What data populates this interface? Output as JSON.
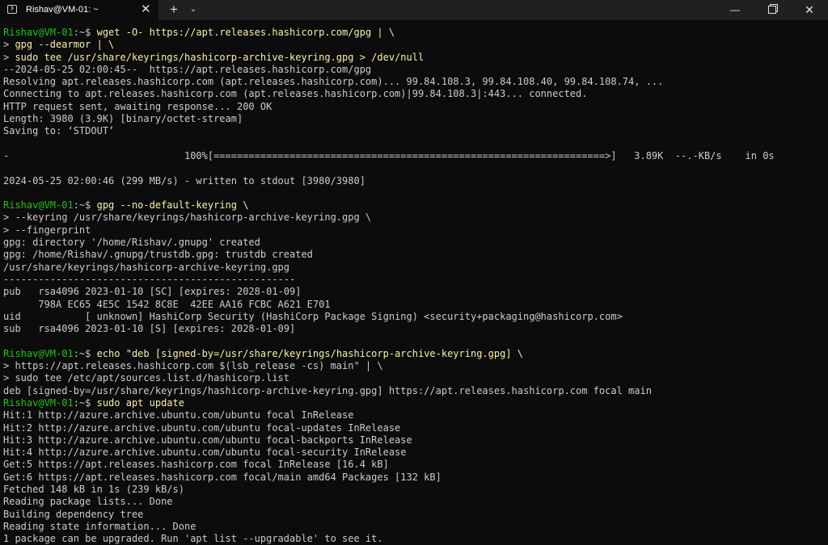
{
  "window": {
    "tab_title": "Rishav@VM-01: ~",
    "tab_close": "✕",
    "new_tab": "+",
    "dropdown": "⌄",
    "minimize": "—",
    "close": "✕"
  },
  "terminal": {
    "prompt_user": "Rishav@VM-01",
    "prompt_path": ":~$ ",
    "lines": [
      {
        "kind": "prompt",
        "cmd": "wget -O- https://apt.releases.hashicorp.com/gpg | \\"
      },
      {
        "kind": "cont",
        "text": "> ",
        "cmd": "gpg --dearmor | \\"
      },
      {
        "kind": "cont",
        "text": "> ",
        "cmd": "sudo tee /usr/share/keyrings/hashicorp-archive-keyring.gpg > /dev/null"
      },
      {
        "kind": "out",
        "text": "--2024-05-25 02:00:45--  https://apt.releases.hashicorp.com/gpg"
      },
      {
        "kind": "out",
        "text": "Resolving apt.releases.hashicorp.com (apt.releases.hashicorp.com)... 99.84.108.3, 99.84.108.40, 99.84.108.74, ..."
      },
      {
        "kind": "out",
        "text": "Connecting to apt.releases.hashicorp.com (apt.releases.hashicorp.com)|99.84.108.3|:443... connected."
      },
      {
        "kind": "out",
        "text": "HTTP request sent, awaiting response... 200 OK"
      },
      {
        "kind": "out",
        "text": "Length: 3980 (3.9K) [binary/octet-stream]"
      },
      {
        "kind": "out",
        "text": "Saving to: ‘STDOUT’"
      },
      {
        "kind": "out",
        "text": ""
      },
      {
        "kind": "out",
        "text": "-                              100%[===================================================================>]   3.89K  --.-KB/s    in 0s"
      },
      {
        "kind": "out",
        "text": ""
      },
      {
        "kind": "out",
        "text": "2024-05-25 02:00:46 (299 MB/s) - written to stdout [3980/3980]"
      },
      {
        "kind": "out",
        "text": ""
      },
      {
        "kind": "prompt",
        "cmd": "gpg --no-default-keyring \\"
      },
      {
        "kind": "cont",
        "text": "> --keyring /usr/share/keyrings/hashicorp-archive-keyring.gpg \\",
        "cmd": ""
      },
      {
        "kind": "cont",
        "text": "> --fingerprint",
        "cmd": ""
      },
      {
        "kind": "out",
        "text": "gpg: directory '/home/Rishav/.gnupg' created"
      },
      {
        "kind": "out",
        "text": "gpg: /home/Rishav/.gnupg/trustdb.gpg: trustdb created"
      },
      {
        "kind": "out",
        "text": "/usr/share/keyrings/hashicorp-archive-keyring.gpg"
      },
      {
        "kind": "out",
        "text": "--------------------------------------------------"
      },
      {
        "kind": "out",
        "text": "pub   rsa4096 2023-01-10 [SC] [expires: 2028-01-09]"
      },
      {
        "kind": "out",
        "text": "      798A EC65 4E5C 1542 8C8E  42EE AA16 FCBC A621 E701"
      },
      {
        "kind": "out",
        "text": "uid           [ unknown] HashiCorp Security (HashiCorp Package Signing) <security+packaging@hashicorp.com>"
      },
      {
        "kind": "out",
        "text": "sub   rsa4096 2023-01-10 [S] [expires: 2028-01-09]"
      },
      {
        "kind": "out",
        "text": ""
      },
      {
        "kind": "prompt",
        "cmd": "echo \"deb [signed-by=/usr/share/keyrings/hashicorp-archive-keyring.gpg] \\"
      },
      {
        "kind": "cont",
        "text": "> https://apt.releases.hashicorp.com $(lsb_release -cs) main\" | \\",
        "cmd": ""
      },
      {
        "kind": "cont",
        "text": "> sudo tee /etc/apt/sources.list.d/hashicorp.list",
        "cmd": ""
      },
      {
        "kind": "out",
        "text": "deb [signed-by=/usr/share/keyrings/hashicorp-archive-keyring.gpg] https://apt.releases.hashicorp.com focal main"
      },
      {
        "kind": "prompt",
        "cmd": "sudo apt update"
      },
      {
        "kind": "out",
        "text": "Hit:1 http://azure.archive.ubuntu.com/ubuntu focal InRelease"
      },
      {
        "kind": "out",
        "text": "Hit:2 http://azure.archive.ubuntu.com/ubuntu focal-updates InRelease"
      },
      {
        "kind": "out",
        "text": "Hit:3 http://azure.archive.ubuntu.com/ubuntu focal-backports InRelease"
      },
      {
        "kind": "out",
        "text": "Hit:4 http://azure.archive.ubuntu.com/ubuntu focal-security InRelease"
      },
      {
        "kind": "out",
        "text": "Get:5 https://apt.releases.hashicorp.com focal InRelease [16.4 kB]"
      },
      {
        "kind": "out",
        "text": "Get:6 https://apt.releases.hashicorp.com focal/main amd64 Packages [132 kB]"
      },
      {
        "kind": "out",
        "text": "Fetched 148 kB in 1s (239 kB/s)"
      },
      {
        "kind": "out",
        "text": "Reading package lists... Done"
      },
      {
        "kind": "out",
        "text": "Building dependency tree"
      },
      {
        "kind": "out",
        "text": "Reading state information... Done"
      },
      {
        "kind": "out",
        "text": "1 package can be upgraded. Run 'apt list --upgradable' to see it."
      }
    ]
  },
  "colors": {
    "background": "#0c0c0c",
    "titlebar": "#202020",
    "prompt_user": "#16c60c",
    "command": "#f9f1a5",
    "output": "#cccccc"
  }
}
